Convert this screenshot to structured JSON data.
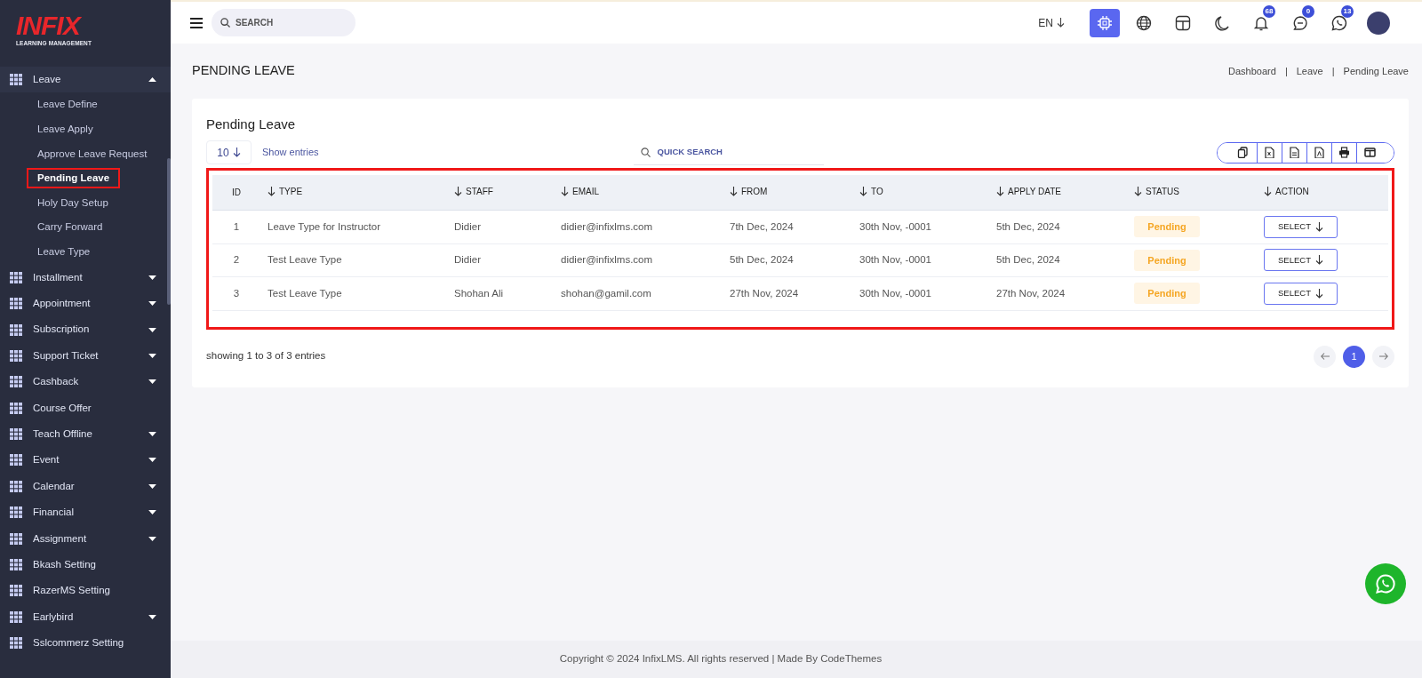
{
  "logo": {
    "text": "INFIX",
    "tagline": "LEARNING MANAGEMENT"
  },
  "sidebar": {
    "items": [
      {
        "label": "Leave",
        "kind": "group",
        "expanded": true,
        "children": [
          {
            "label": "Leave Define",
            "selected": false,
            "highlighted": false
          },
          {
            "label": "Leave Apply",
            "selected": false,
            "highlighted": false
          },
          {
            "label": "Approve Leave Request",
            "selected": false,
            "highlighted": false
          },
          {
            "label": "Pending Leave",
            "selected": true,
            "highlighted": true
          },
          {
            "label": "Holy Day Setup",
            "selected": false,
            "highlighted": false
          },
          {
            "label": "Carry Forward",
            "selected": false,
            "highlighted": false
          },
          {
            "label": "Leave Type",
            "selected": false,
            "highlighted": false
          }
        ]
      },
      {
        "label": "Installment",
        "kind": "group",
        "expanded": false
      },
      {
        "label": "Appointment",
        "kind": "group",
        "expanded": false
      },
      {
        "label": "Subscription",
        "kind": "group",
        "expanded": false
      },
      {
        "label": "Support Ticket",
        "kind": "group",
        "expanded": false
      },
      {
        "label": "Cashback",
        "kind": "group",
        "expanded": false
      },
      {
        "label": "Course Offer",
        "kind": "link"
      },
      {
        "label": "Teach Offline",
        "kind": "group",
        "expanded": false
      },
      {
        "label": "Event",
        "kind": "group",
        "expanded": false
      },
      {
        "label": "Calendar",
        "kind": "group",
        "expanded": false
      },
      {
        "label": "Financial",
        "kind": "group",
        "expanded": false
      },
      {
        "label": "Assignment",
        "kind": "group",
        "expanded": false
      },
      {
        "label": "Bkash Setting",
        "kind": "link"
      },
      {
        "label": "RazerMS Setting",
        "kind": "link"
      },
      {
        "label": "Earlybird",
        "kind": "group",
        "expanded": false
      },
      {
        "label": "Sslcommerz Setting",
        "kind": "link"
      }
    ]
  },
  "topbar": {
    "search": {
      "placeholder": "SEARCH"
    },
    "language": "EN",
    "icons": [
      {
        "kind": "chip",
        "active": true
      },
      {
        "kind": "globe",
        "active": false
      },
      {
        "kind": "layout",
        "active": false
      },
      {
        "kind": "moon",
        "active": false
      },
      {
        "kind": "bell",
        "active": false,
        "badge": "68"
      },
      {
        "kind": "chat",
        "active": false,
        "badge": "0"
      },
      {
        "kind": "phone",
        "active": false,
        "badge": "13"
      }
    ]
  },
  "page": {
    "title": "PENDING LEAVE",
    "breadcrumb_separator": "|",
    "breadcrumb": [
      "Dashboard",
      "Leave",
      "Pending Leave"
    ]
  },
  "card": {
    "title": "Pending Leave",
    "page_size": "10",
    "page_size_label": "Show entries",
    "quick_search": {
      "placeholder": "QUICK SEARCH"
    },
    "export_buttons": [
      {
        "kind": "copy"
      },
      {
        "kind": "excel"
      },
      {
        "kind": "csv"
      },
      {
        "kind": "pdf"
      },
      {
        "kind": "print"
      },
      {
        "kind": "columns"
      }
    ]
  },
  "table": {
    "highlighted": true,
    "columns": [
      {
        "label": "ID",
        "sortable": false
      },
      {
        "label": "TYPE",
        "sortable": true
      },
      {
        "label": "STAFF",
        "sortable": true
      },
      {
        "label": "EMAIL",
        "sortable": true
      },
      {
        "label": "FROM",
        "sortable": true
      },
      {
        "label": "TO",
        "sortable": true
      },
      {
        "label": "APPLY DATE",
        "sortable": true
      },
      {
        "label": "STATUS",
        "sortable": true
      },
      {
        "label": "ACTION",
        "sortable": true
      }
    ],
    "rows": [
      {
        "id": "1",
        "type": "Leave Type for Instructor",
        "staff": "Didier",
        "email": "didier@infixlms.com",
        "from": "7th Dec, 2024",
        "to": "30th Nov, -0001",
        "apply_date": "5th Dec, 2024",
        "status": "Pending",
        "action": "SELECT"
      },
      {
        "id": "2",
        "type": "Test Leave Type",
        "staff": "Didier",
        "email": "didier@infixlms.com",
        "from": "5th Dec, 2024",
        "to": "30th Nov, -0001",
        "apply_date": "5th Dec, 2024",
        "status": "Pending",
        "action": "SELECT"
      },
      {
        "id": "3",
        "type": "Test Leave Type",
        "staff": "Shohan Ali",
        "email": "shohan@gamil.com",
        "from": "27th Nov, 2024",
        "to": "30th Nov, -0001",
        "apply_date": "27th Nov, 2024",
        "status": "Pending",
        "action": "SELECT"
      }
    ]
  },
  "table_footer": {
    "info": "showing 1 to 3 of 3 entries",
    "pages": [
      {
        "label": "1",
        "selected": true
      }
    ]
  },
  "footer": {
    "copyright": "Copyright © 2024 InfixLMS. All rights reserved | Made By CodeThemes"
  }
}
